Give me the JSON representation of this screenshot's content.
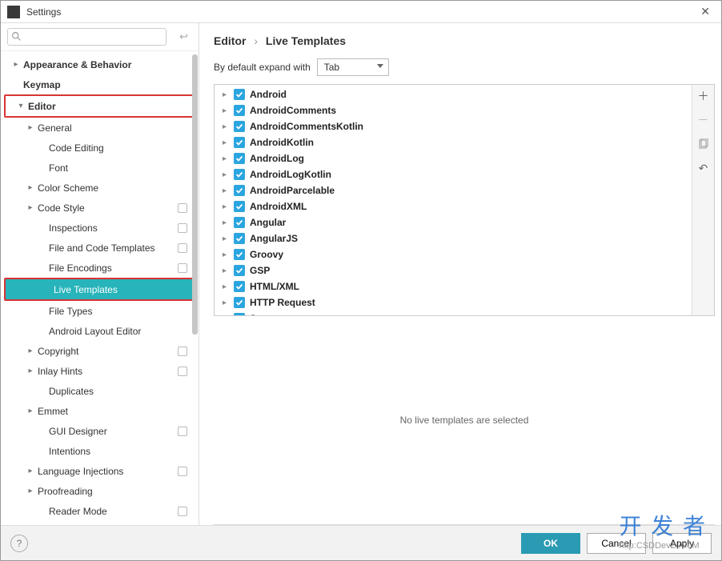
{
  "window": {
    "title": "Settings"
  },
  "search": {
    "placeholder": ""
  },
  "sidebar": {
    "items": [
      {
        "label": "Appearance & Behavior",
        "level": 0,
        "arrow": "right",
        "bold": true
      },
      {
        "label": "Keymap",
        "level": 0,
        "arrow": "",
        "bold": true
      },
      {
        "label": "Editor",
        "level": 0,
        "arrow": "down",
        "bold": true,
        "redbox": true
      },
      {
        "label": "General",
        "level": 1,
        "arrow": "right"
      },
      {
        "label": "Code Editing",
        "level": 2,
        "arrow": ""
      },
      {
        "label": "Font",
        "level": 2,
        "arrow": ""
      },
      {
        "label": "Color Scheme",
        "level": 1,
        "arrow": "right"
      },
      {
        "label": "Code Style",
        "level": 1,
        "arrow": "right",
        "mod": true
      },
      {
        "label": "Inspections",
        "level": 2,
        "arrow": "",
        "mod": true
      },
      {
        "label": "File and Code Templates",
        "level": 2,
        "arrow": "",
        "mod": true
      },
      {
        "label": "File Encodings",
        "level": 2,
        "arrow": "",
        "mod": true
      },
      {
        "label": "Live Templates",
        "level": 2,
        "arrow": "",
        "selected": true,
        "redbox": true
      },
      {
        "label": "File Types",
        "level": 2,
        "arrow": ""
      },
      {
        "label": "Android Layout Editor",
        "level": 2,
        "arrow": ""
      },
      {
        "label": "Copyright",
        "level": 1,
        "arrow": "right",
        "mod": true
      },
      {
        "label": "Inlay Hints",
        "level": 1,
        "arrow": "right",
        "mod": true
      },
      {
        "label": "Duplicates",
        "level": 2,
        "arrow": ""
      },
      {
        "label": "Emmet",
        "level": 1,
        "arrow": "right"
      },
      {
        "label": "GUI Designer",
        "level": 2,
        "arrow": "",
        "mod": true
      },
      {
        "label": "Intentions",
        "level": 2,
        "arrow": ""
      },
      {
        "label": "Language Injections",
        "level": 1,
        "arrow": "right",
        "mod": true
      },
      {
        "label": "Proofreading",
        "level": 1,
        "arrow": "right"
      },
      {
        "label": "Reader Mode",
        "level": 2,
        "arrow": "",
        "mod": true
      }
    ]
  },
  "breadcrumb": {
    "a": "Editor",
    "b": "Live Templates"
  },
  "expand": {
    "label": "By default expand with",
    "value": "Tab"
  },
  "templates": [
    {
      "label": "Android",
      "checked": true
    },
    {
      "label": "AndroidComments",
      "checked": true
    },
    {
      "label": "AndroidCommentsKotlin",
      "checked": true
    },
    {
      "label": "AndroidKotlin",
      "checked": true
    },
    {
      "label": "AndroidLog",
      "checked": true
    },
    {
      "label": "AndroidLogKotlin",
      "checked": true
    },
    {
      "label": "AndroidParcelable",
      "checked": true
    },
    {
      "label": "AndroidXML",
      "checked": true
    },
    {
      "label": "Angular",
      "checked": true
    },
    {
      "label": "AngularJS",
      "checked": true
    },
    {
      "label": "Groovy",
      "checked": true
    },
    {
      "label": "GSP",
      "checked": true
    },
    {
      "label": "HTML/XML",
      "checked": true
    },
    {
      "label": "HTTP Request",
      "checked": true
    },
    {
      "label": "Java",
      "checked": true
    }
  ],
  "detail": {
    "empty": "No live templates are selected"
  },
  "buttons": {
    "ok": "OK",
    "cancel": "Cancel",
    "apply": "Apply"
  },
  "watermark": {
    "cn": "开 发 者",
    "en": "http:CSDDevZeCoM"
  }
}
